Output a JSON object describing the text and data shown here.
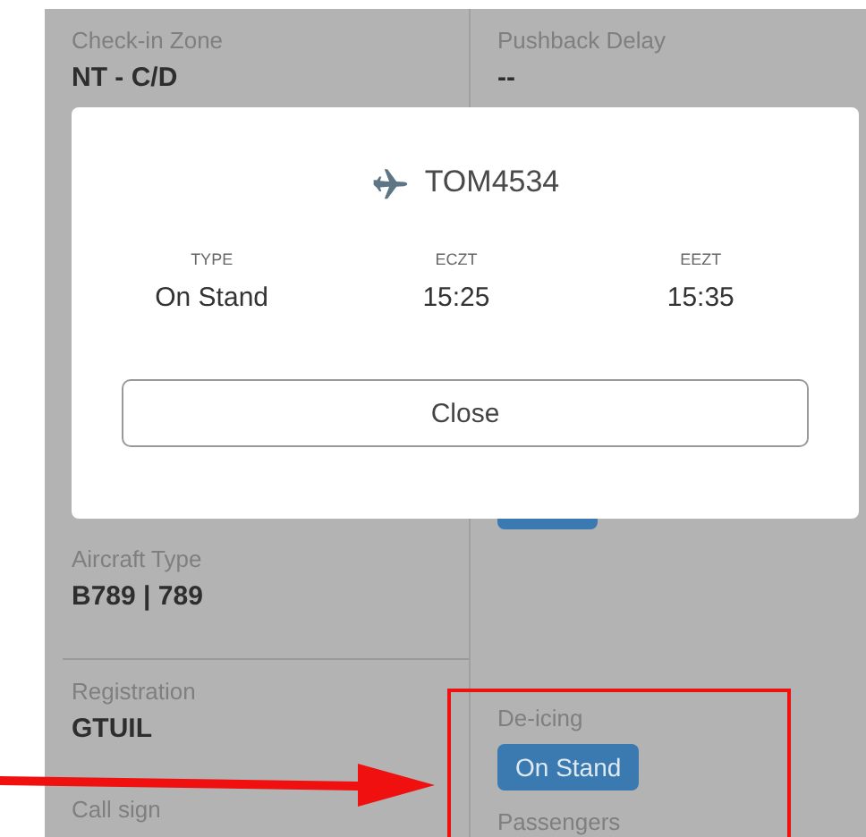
{
  "details": {
    "left": [
      {
        "label": "Check-in Zone",
        "value": "NT - C/D"
      },
      {
        "label": "Aircraft Type",
        "value": "B789 | 789"
      },
      {
        "label": "Registration",
        "value": "GTUIL"
      },
      {
        "label": "Call sign"
      }
    ],
    "right": [
      {
        "label": "Pushback Delay",
        "value": "--"
      },
      {
        "label": "De-icing",
        "chip": "On Stand"
      },
      {
        "label": "Passengers"
      }
    ]
  },
  "dialog": {
    "flight": "TOM4534",
    "fields": [
      {
        "label": "TYPE",
        "value": "On Stand"
      },
      {
        "label": "ECZT",
        "value": "15:25"
      },
      {
        "label": "EEZT",
        "value": "15:35"
      }
    ],
    "button": "Close"
  }
}
